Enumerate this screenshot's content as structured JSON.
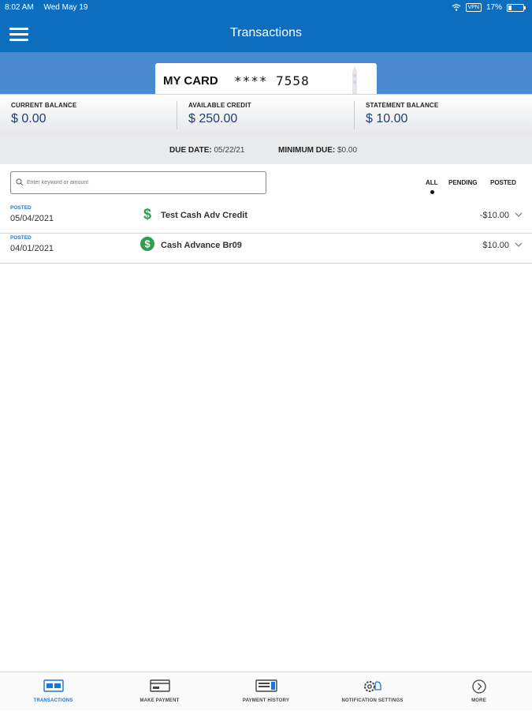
{
  "status_bar": {
    "time": "8:02 AM",
    "date": "Wed May 19",
    "vpn": "VPN",
    "battery": "17%"
  },
  "header": {
    "title": "Transactions"
  },
  "card": {
    "name": "MY CARD",
    "number": "**** 7558"
  },
  "balances": [
    {
      "label": "CURRENT BALANCE",
      "value": "$ 0.00"
    },
    {
      "label": "AVAILABLE CREDIT",
      "value": "$ 250.00"
    },
    {
      "label": "STATEMENT BALANCE",
      "value": "$ 10.00"
    }
  ],
  "due": {
    "due_label": "DUE DATE:",
    "due_value": "05/22/21",
    "min_label": "MINIMUM DUE:",
    "min_value": "$0.00"
  },
  "search": {
    "placeholder": "Enter keyword or amount"
  },
  "filters": {
    "all": "ALL",
    "pending": "PENDING",
    "posted": "POSTED",
    "selected": "ALL"
  },
  "transactions": [
    {
      "status": "POSTED",
      "date": "05/04/2021",
      "icon": "dollar-icon",
      "description": "Test Cash Adv Credit",
      "amount": "-$10.00"
    },
    {
      "status": "POSTED",
      "date": "04/01/2021",
      "icon": "dollar-circle-icon",
      "description": "Cash Advance Br09",
      "amount": "$10.00"
    }
  ],
  "tabs": [
    {
      "label": "TRANSACTIONS",
      "icon": "card-icon"
    },
    {
      "label": "MAKE PAYMENT",
      "icon": "payment-card-icon"
    },
    {
      "label": "PAYMENT HISTORY",
      "icon": "history-icon"
    },
    {
      "label": "NOTIFICATION SETTINGS",
      "icon": "settings-icon"
    },
    {
      "label": "MORE",
      "icon": "more-icon"
    }
  ],
  "colors": {
    "brand": "#0d6dbf",
    "band": "#4a8bd0",
    "accent": "#1a77d2",
    "dollar": "#2e9e4e",
    "balance_text": "#1f3e73"
  }
}
